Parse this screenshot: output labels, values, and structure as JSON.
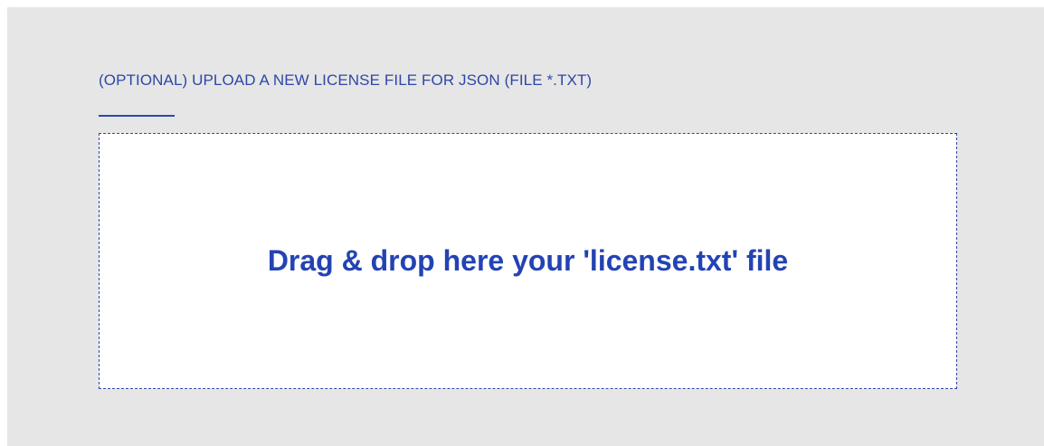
{
  "upload_section": {
    "title": "(OPTIONAL) UPLOAD A NEW LICENSE FILE FOR JSON (FILE *.TXT)",
    "dropzone_text": "Drag & drop here your 'license.txt' file"
  },
  "colors": {
    "panel_background": "#e6e6e6",
    "accent": "#2e47a8",
    "dropzone_text": "#2343b4",
    "dropzone_background": "#ffffff"
  }
}
